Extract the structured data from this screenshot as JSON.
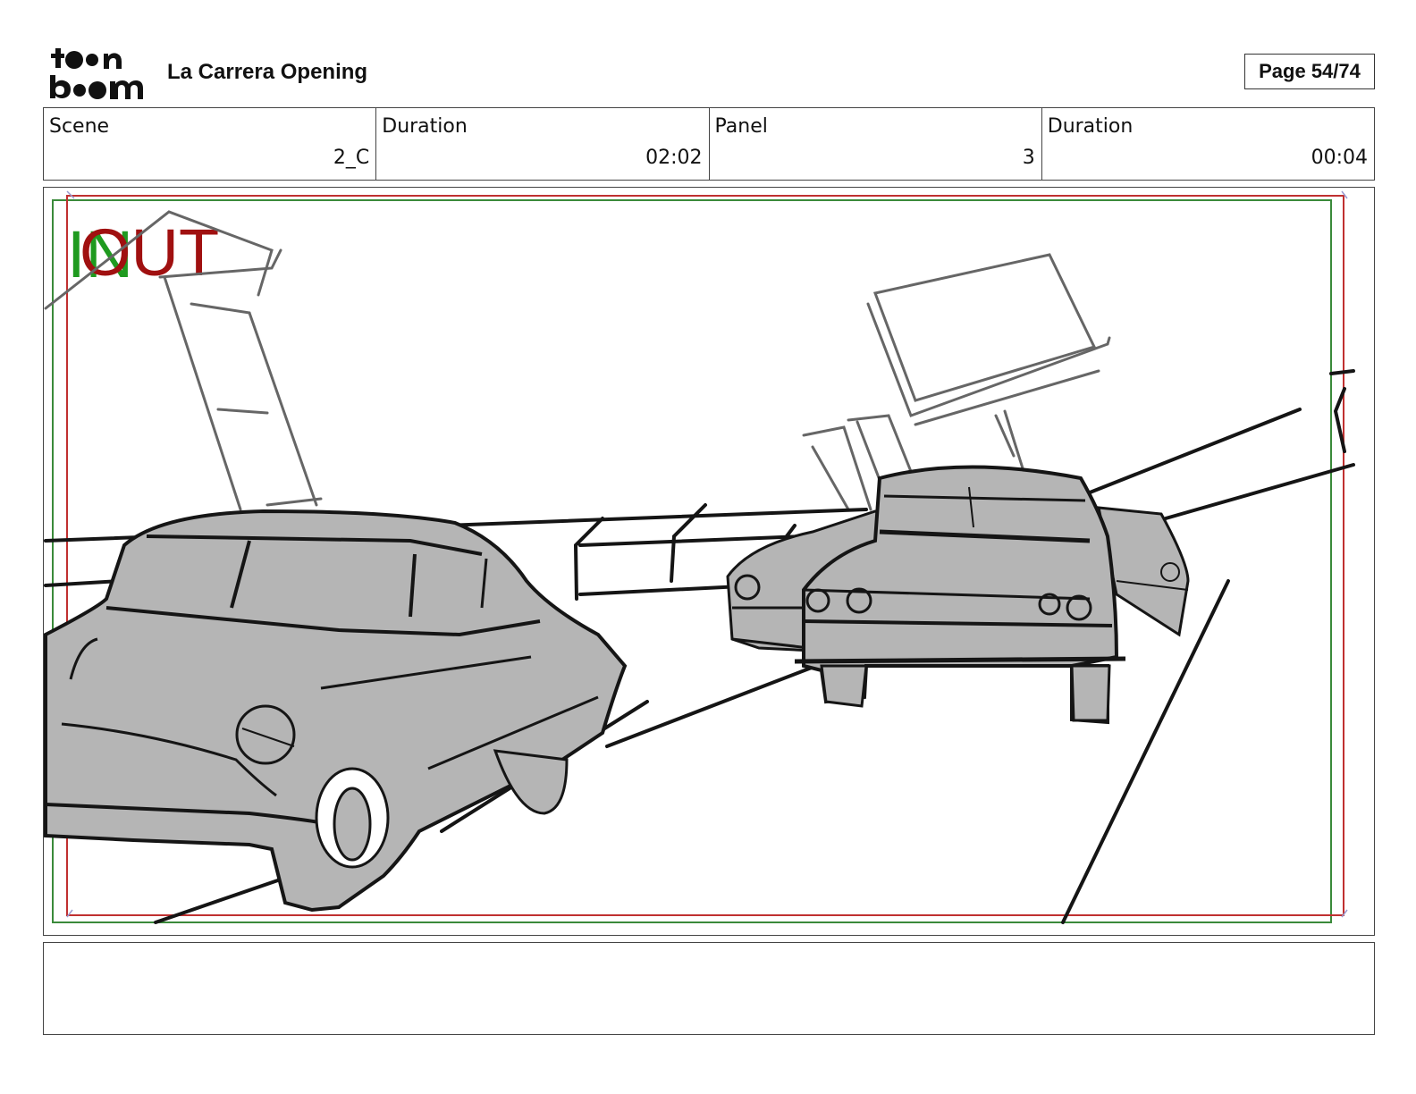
{
  "header": {
    "logo_text": "toon boom",
    "project_title": "La Carrera Opening",
    "page_label": "Page 54/74"
  },
  "info": [
    {
      "label": "Scene",
      "value": "2_C"
    },
    {
      "label": "Duration",
      "value": "02:02"
    },
    {
      "label": "Panel",
      "value": "3"
    },
    {
      "label": "Duration",
      "value": "00:04"
    }
  ],
  "panel": {
    "in_marker": "IN",
    "out_marker": "OUT",
    "colors": {
      "in": "#1f9a1f",
      "out": "#a01010",
      "safe_green": "#3a8a3a",
      "safe_red": "#c03030",
      "car_fill": "#b5b5b5",
      "line": "#151515",
      "sign_line": "#666666"
    }
  },
  "notes": {
    "text": ""
  }
}
